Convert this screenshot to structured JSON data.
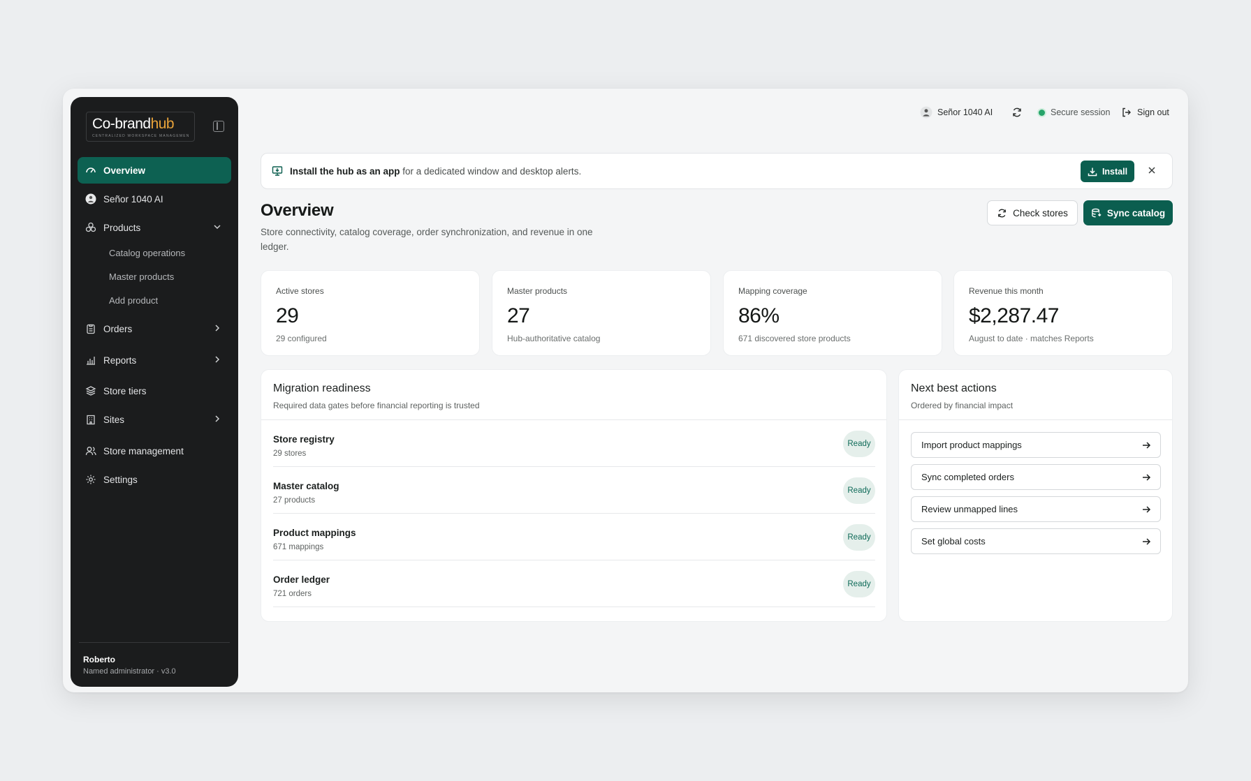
{
  "app": {
    "logo_part1": "Co-brand",
    "logo_part2": "hub",
    "logo_tagline": "CENTRALIZED WORKSPACE MANAGEMENT"
  },
  "sidebar": {
    "items": [
      {
        "label": "Overview",
        "icon": "gauge-icon"
      },
      {
        "label": "Señor 1040 AI",
        "icon": "avatar-icon"
      },
      {
        "label": "Products",
        "icon": "cubes-icon"
      },
      {
        "label": "Orders",
        "icon": "clipboard-icon"
      },
      {
        "label": "Reports",
        "icon": "bar-chart-icon"
      },
      {
        "label": "Store tiers",
        "icon": "layers-icon"
      },
      {
        "label": "Sites",
        "icon": "building-icon"
      },
      {
        "label": "Store management",
        "icon": "users-icon"
      },
      {
        "label": "Settings",
        "icon": "gear-icon"
      }
    ],
    "products_sub": [
      "Catalog operations",
      "Master products",
      "Add product"
    ],
    "user": {
      "name": "Roberto",
      "role": "Named administrator · v3.0"
    }
  },
  "topbar": {
    "account": "Señor 1040 AI",
    "session": "Secure session",
    "signout": "Sign out"
  },
  "banner": {
    "bold": "Install the hub as an app",
    "rest": " for a dedicated window and desktop alerts.",
    "install_label": "Install"
  },
  "page": {
    "title": "Overview",
    "description": "Store connectivity, catalog coverage, order synchronization, and revenue in one ledger.",
    "check_stores": "Check stores",
    "sync_catalog": "Sync catalog"
  },
  "stats": [
    {
      "label": "Active stores",
      "value": "29",
      "note": "29 configured"
    },
    {
      "label": "Master products",
      "value": "27",
      "note": "Hub-authoritative catalog"
    },
    {
      "label": "Mapping coverage",
      "value": "86%",
      "note": "671 discovered store products"
    },
    {
      "label": "Revenue this month",
      "value": "$2,287.47",
      "note": "August to date · matches Reports"
    }
  ],
  "migration": {
    "title": "Migration readiness",
    "subtitle": "Required data gates before financial reporting is trusted",
    "rows": [
      {
        "title": "Store registry",
        "sub": "29 stores",
        "status": "Ready"
      },
      {
        "title": "Master catalog",
        "sub": "27 products",
        "status": "Ready"
      },
      {
        "title": "Product mappings",
        "sub": "671 mappings",
        "status": "Ready"
      },
      {
        "title": "Order ledger",
        "sub": "721 orders",
        "status": "Ready"
      }
    ]
  },
  "actions": {
    "title": "Next best actions",
    "subtitle": "Ordered by financial impact",
    "items": [
      "Import product mappings",
      "Sync completed orders",
      "Review unmapped lines",
      "Set global costs"
    ]
  },
  "colors": {
    "accent": "#0b5e4f",
    "sidebar": "#1b1c1d",
    "logo_highlight": "#e8a33a",
    "session_dot": "#27a46a"
  }
}
